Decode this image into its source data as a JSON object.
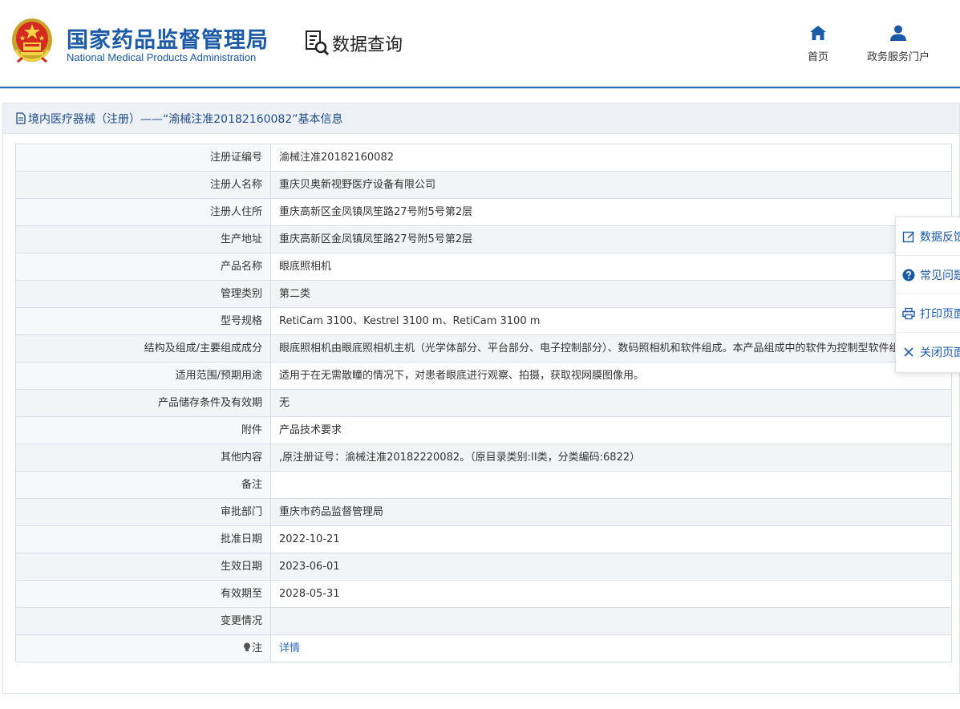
{
  "header": {
    "org_name_cn": "国家药品监督管理局",
    "org_name_en": "National Medical Products Administration",
    "query_label": "数据查询",
    "nav": {
      "home_label": "首页",
      "portal_label": "政务服务门户"
    },
    "brand_color": "#1a5aa6"
  },
  "panel": {
    "title": "境内医疗器械（注册）——“渝械注准20182160082”基本信息"
  },
  "rows": [
    {
      "label": "注册证编号",
      "value": "渝械注准20182160082"
    },
    {
      "label": "注册人名称",
      "value": "重庆贝奥新视野医疗设备有限公司"
    },
    {
      "label": "注册人住所",
      "value": "重庆高新区金凤镇凤笙路27号附5号第2层"
    },
    {
      "label": "生产地址",
      "value": "重庆高新区金凤镇凤笙路27号附5号第2层"
    },
    {
      "label": "产品名称",
      "value": "眼底照相机"
    },
    {
      "label": "管理类别",
      "value": "第二类"
    },
    {
      "label": "型号规格",
      "value": "RetiCam 3100、Kestrel 3100 m、RetiCam 3100 m"
    },
    {
      "label": "结构及组成/主要组成成分",
      "value": "眼底照相机由眼底照相机主机（光学体部分、平台部分、电子控制部分）、数码照相机和软件组成。本产品组成中的软件为控制型软件组件。"
    },
    {
      "label": "适用范围/预期用途",
      "value": "适用于在无需散瞳的情况下，对患者眼底进行观察、拍摄，获取视网膜图像用。"
    },
    {
      "label": "产品储存条件及有效期",
      "value": "无"
    },
    {
      "label": "附件",
      "value": "产品技术要求"
    },
    {
      "label": "其他内容",
      "value": ",原注册证号：渝械注准20182220082。（原目录类别:II类，分类编码:6822）"
    },
    {
      "label": "备注",
      "value": ""
    },
    {
      "label": "审批部门",
      "value": "重庆市药品监督管理局"
    },
    {
      "label": "批准日期",
      "value": "2022-10-21"
    },
    {
      "label": "生效日期",
      "value": "2023-06-01"
    },
    {
      "label": "有效期至",
      "value": "2028-05-31"
    },
    {
      "label": "变更情况",
      "value": ""
    },
    {
      "label": "注",
      "value": "详情"
    }
  ],
  "sidebar": {
    "items": [
      {
        "label": "数据反馈",
        "icon": "edit-icon"
      },
      {
        "label": "常见问题",
        "icon": "question-icon"
      },
      {
        "label": "打印页面",
        "icon": "print-icon"
      },
      {
        "label": "关闭页面",
        "icon": "close-icon"
      }
    ]
  }
}
